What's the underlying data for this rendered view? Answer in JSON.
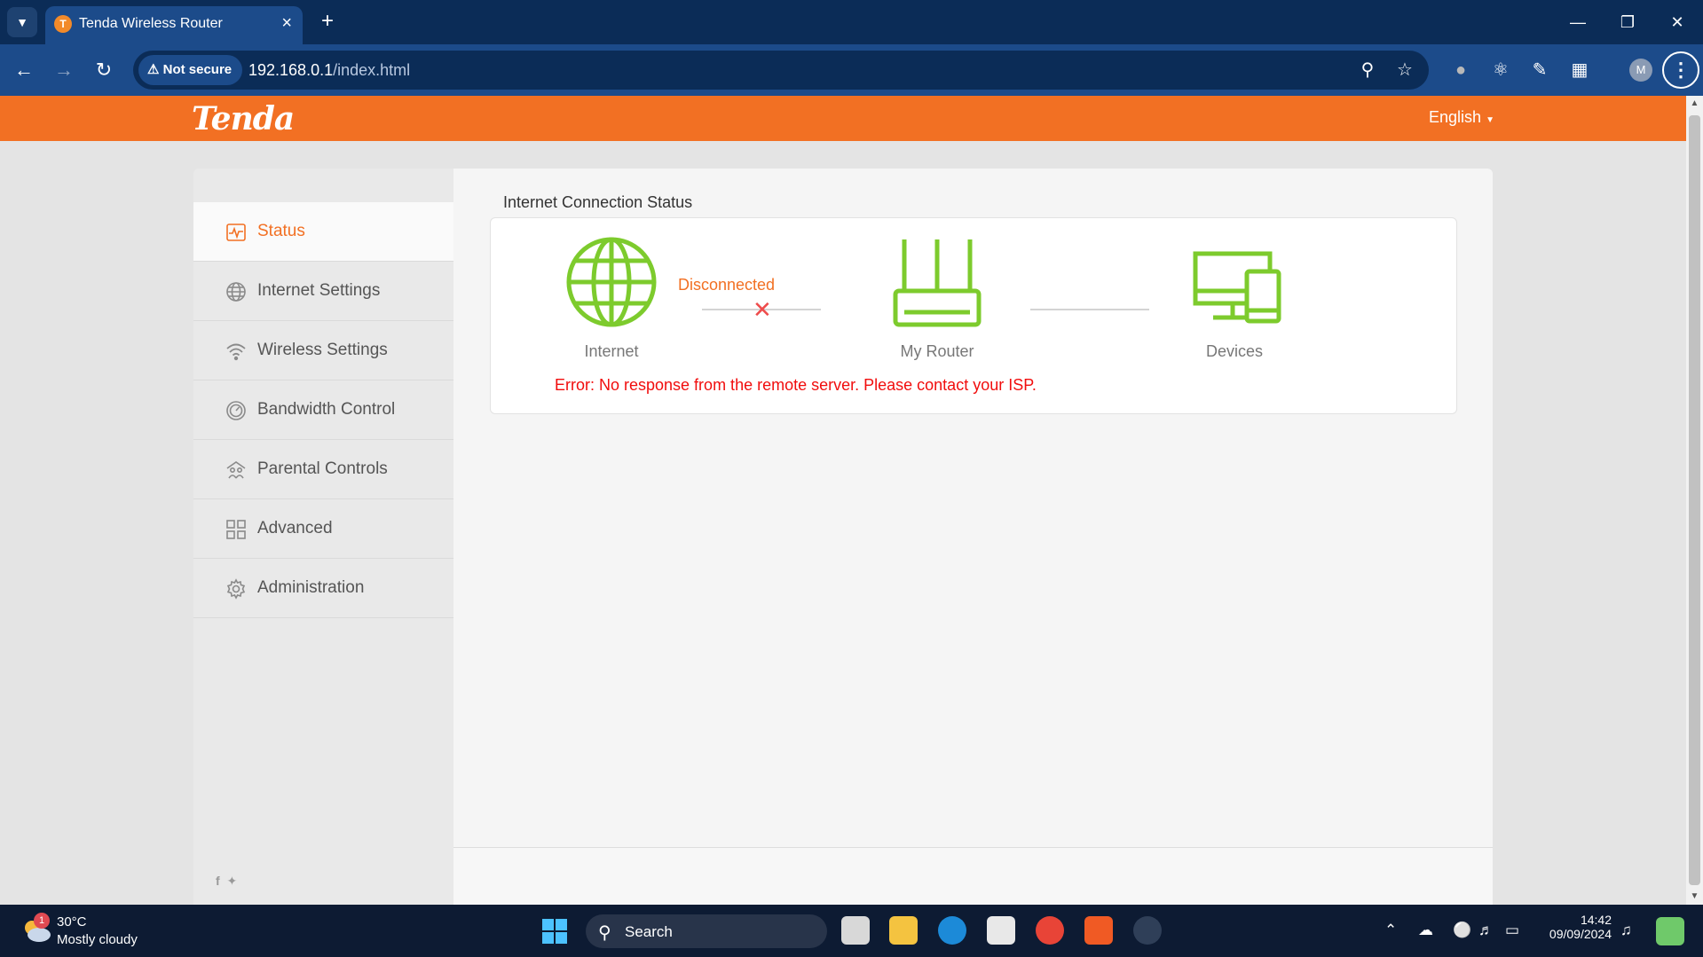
{
  "browser": {
    "tab_title": "Tenda Wireless Router",
    "security_label": "Not secure",
    "url_host": "192.168.0.1",
    "url_path": "/index.html",
    "profile_initial": "M"
  },
  "header": {
    "logo": "Tenda",
    "language": "English"
  },
  "sidebar": {
    "items": [
      {
        "label": "Status",
        "icon": "status-icon"
      },
      {
        "label": "Internet Settings",
        "icon": "globe-icon"
      },
      {
        "label": "Wireless Settings",
        "icon": "wifi-icon"
      },
      {
        "label": "Bandwidth Control",
        "icon": "gauge-icon"
      },
      {
        "label": "Parental Controls",
        "icon": "parental-icon"
      },
      {
        "label": "Advanced",
        "icon": "grid-icon"
      },
      {
        "label": "Administration",
        "icon": "gear-icon"
      }
    ]
  },
  "main": {
    "section_title": "Internet Connection Status",
    "nodes": {
      "internet": "Internet",
      "router": "My Router",
      "devices": "Devices"
    },
    "link_status": "Disconnected",
    "error": "Error: No response from the remote server. Please contact your ISP."
  },
  "colors": {
    "brand_orange": "#f27023",
    "icon_green": "#7dcb2d",
    "error_red": "#f10d0d"
  },
  "taskbar": {
    "weather_badge": "1",
    "temperature": "30°C",
    "condition": "Mostly cloudy",
    "search_label": "Search",
    "time": "14:42",
    "date": "09/09/2024"
  }
}
